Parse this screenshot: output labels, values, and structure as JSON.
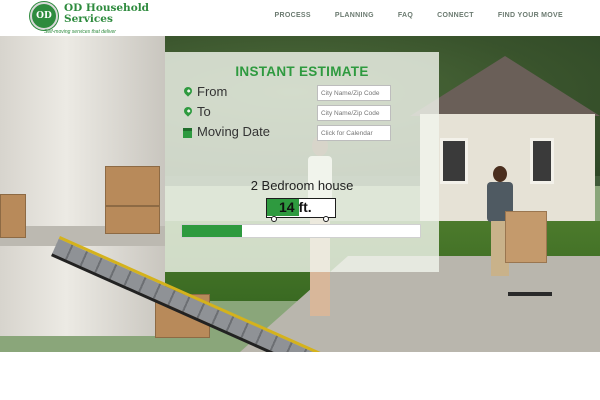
{
  "brand": {
    "badge": "OD",
    "name": "OD Household Services",
    "tagline": "Self-moving services that deliver",
    "color": "#2e8b3e"
  },
  "nav": {
    "items": [
      "PROCESS",
      "PLANNING",
      "FAQ",
      "CONNECT",
      "FIND YOUR MOVE"
    ]
  },
  "estimate": {
    "title": "INSTANT ESTIMATE",
    "from_label": "From",
    "from_placeholder": "City Name/Zip Code",
    "to_label": "To",
    "to_placeholder": "City Name/Zip Code",
    "date_label": "Moving Date",
    "date_placeholder": "Click for Calendar",
    "house_size": "2 Bedroom house",
    "truck_size": "14 ft.",
    "size_slider_fraction": 0.25
  },
  "colors": {
    "accent": "#2e9a3f",
    "nav_text": "#6b7a70"
  }
}
